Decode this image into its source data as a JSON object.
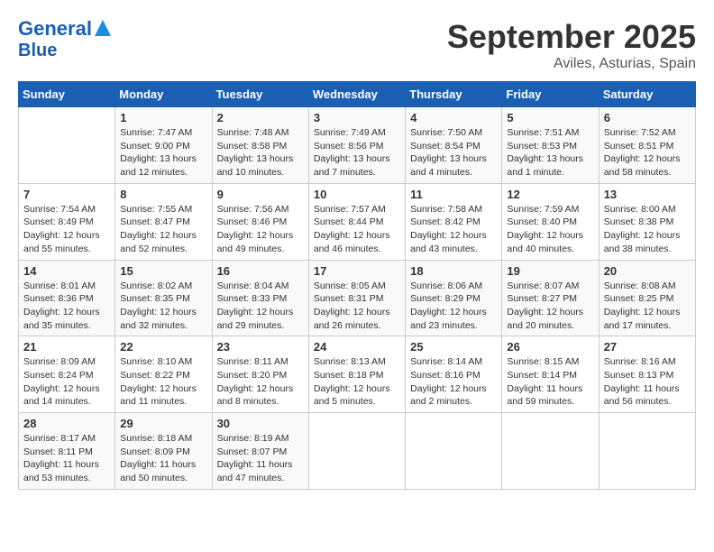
{
  "header": {
    "logo_line1": "General",
    "logo_line2": "Blue",
    "month": "September 2025",
    "location": "Aviles, Asturias, Spain"
  },
  "days_of_week": [
    "Sunday",
    "Monday",
    "Tuesday",
    "Wednesday",
    "Thursday",
    "Friday",
    "Saturday"
  ],
  "weeks": [
    [
      {
        "day": "",
        "sunrise": "",
        "sunset": "",
        "daylight": ""
      },
      {
        "day": "1",
        "sunrise": "Sunrise: 7:47 AM",
        "sunset": "Sunset: 9:00 PM",
        "daylight": "Daylight: 13 hours and 12 minutes."
      },
      {
        "day": "2",
        "sunrise": "Sunrise: 7:48 AM",
        "sunset": "Sunset: 8:58 PM",
        "daylight": "Daylight: 13 hours and 10 minutes."
      },
      {
        "day": "3",
        "sunrise": "Sunrise: 7:49 AM",
        "sunset": "Sunset: 8:56 PM",
        "daylight": "Daylight: 13 hours and 7 minutes."
      },
      {
        "day": "4",
        "sunrise": "Sunrise: 7:50 AM",
        "sunset": "Sunset: 8:54 PM",
        "daylight": "Daylight: 13 hours and 4 minutes."
      },
      {
        "day": "5",
        "sunrise": "Sunrise: 7:51 AM",
        "sunset": "Sunset: 8:53 PM",
        "daylight": "Daylight: 13 hours and 1 minute."
      },
      {
        "day": "6",
        "sunrise": "Sunrise: 7:52 AM",
        "sunset": "Sunset: 8:51 PM",
        "daylight": "Daylight: 12 hours and 58 minutes."
      }
    ],
    [
      {
        "day": "7",
        "sunrise": "Sunrise: 7:54 AM",
        "sunset": "Sunset: 8:49 PM",
        "daylight": "Daylight: 12 hours and 55 minutes."
      },
      {
        "day": "8",
        "sunrise": "Sunrise: 7:55 AM",
        "sunset": "Sunset: 8:47 PM",
        "daylight": "Daylight: 12 hours and 52 minutes."
      },
      {
        "day": "9",
        "sunrise": "Sunrise: 7:56 AM",
        "sunset": "Sunset: 8:46 PM",
        "daylight": "Daylight: 12 hours and 49 minutes."
      },
      {
        "day": "10",
        "sunrise": "Sunrise: 7:57 AM",
        "sunset": "Sunset: 8:44 PM",
        "daylight": "Daylight: 12 hours and 46 minutes."
      },
      {
        "day": "11",
        "sunrise": "Sunrise: 7:58 AM",
        "sunset": "Sunset: 8:42 PM",
        "daylight": "Daylight: 12 hours and 43 minutes."
      },
      {
        "day": "12",
        "sunrise": "Sunrise: 7:59 AM",
        "sunset": "Sunset: 8:40 PM",
        "daylight": "Daylight: 12 hours and 40 minutes."
      },
      {
        "day": "13",
        "sunrise": "Sunrise: 8:00 AM",
        "sunset": "Sunset: 8:38 PM",
        "daylight": "Daylight: 12 hours and 38 minutes."
      }
    ],
    [
      {
        "day": "14",
        "sunrise": "Sunrise: 8:01 AM",
        "sunset": "Sunset: 8:36 PM",
        "daylight": "Daylight: 12 hours and 35 minutes."
      },
      {
        "day": "15",
        "sunrise": "Sunrise: 8:02 AM",
        "sunset": "Sunset: 8:35 PM",
        "daylight": "Daylight: 12 hours and 32 minutes."
      },
      {
        "day": "16",
        "sunrise": "Sunrise: 8:04 AM",
        "sunset": "Sunset: 8:33 PM",
        "daylight": "Daylight: 12 hours and 29 minutes."
      },
      {
        "day": "17",
        "sunrise": "Sunrise: 8:05 AM",
        "sunset": "Sunset: 8:31 PM",
        "daylight": "Daylight: 12 hours and 26 minutes."
      },
      {
        "day": "18",
        "sunrise": "Sunrise: 8:06 AM",
        "sunset": "Sunset: 8:29 PM",
        "daylight": "Daylight: 12 hours and 23 minutes."
      },
      {
        "day": "19",
        "sunrise": "Sunrise: 8:07 AM",
        "sunset": "Sunset: 8:27 PM",
        "daylight": "Daylight: 12 hours and 20 minutes."
      },
      {
        "day": "20",
        "sunrise": "Sunrise: 8:08 AM",
        "sunset": "Sunset: 8:25 PM",
        "daylight": "Daylight: 12 hours and 17 minutes."
      }
    ],
    [
      {
        "day": "21",
        "sunrise": "Sunrise: 8:09 AM",
        "sunset": "Sunset: 8:24 PM",
        "daylight": "Daylight: 12 hours and 14 minutes."
      },
      {
        "day": "22",
        "sunrise": "Sunrise: 8:10 AM",
        "sunset": "Sunset: 8:22 PM",
        "daylight": "Daylight: 12 hours and 11 minutes."
      },
      {
        "day": "23",
        "sunrise": "Sunrise: 8:11 AM",
        "sunset": "Sunset: 8:20 PM",
        "daylight": "Daylight: 12 hours and 8 minutes."
      },
      {
        "day": "24",
        "sunrise": "Sunrise: 8:13 AM",
        "sunset": "Sunset: 8:18 PM",
        "daylight": "Daylight: 12 hours and 5 minutes."
      },
      {
        "day": "25",
        "sunrise": "Sunrise: 8:14 AM",
        "sunset": "Sunset: 8:16 PM",
        "daylight": "Daylight: 12 hours and 2 minutes."
      },
      {
        "day": "26",
        "sunrise": "Sunrise: 8:15 AM",
        "sunset": "Sunset: 8:14 PM",
        "daylight": "Daylight: 11 hours and 59 minutes."
      },
      {
        "day": "27",
        "sunrise": "Sunrise: 8:16 AM",
        "sunset": "Sunset: 8:13 PM",
        "daylight": "Daylight: 11 hours and 56 minutes."
      }
    ],
    [
      {
        "day": "28",
        "sunrise": "Sunrise: 8:17 AM",
        "sunset": "Sunset: 8:11 PM",
        "daylight": "Daylight: 11 hours and 53 minutes."
      },
      {
        "day": "29",
        "sunrise": "Sunrise: 8:18 AM",
        "sunset": "Sunset: 8:09 PM",
        "daylight": "Daylight: 11 hours and 50 minutes."
      },
      {
        "day": "30",
        "sunrise": "Sunrise: 8:19 AM",
        "sunset": "Sunset: 8:07 PM",
        "daylight": "Daylight: 11 hours and 47 minutes."
      },
      {
        "day": "",
        "sunrise": "",
        "sunset": "",
        "daylight": ""
      },
      {
        "day": "",
        "sunrise": "",
        "sunset": "",
        "daylight": ""
      },
      {
        "day": "",
        "sunrise": "",
        "sunset": "",
        "daylight": ""
      },
      {
        "day": "",
        "sunrise": "",
        "sunset": "",
        "daylight": ""
      }
    ]
  ]
}
